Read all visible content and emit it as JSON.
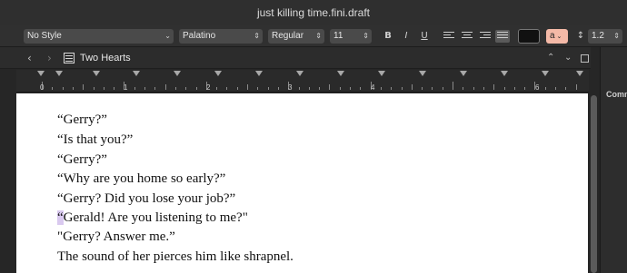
{
  "window": {
    "title": "just killing time.fini.draft"
  },
  "format_bar": {
    "style_select": "No Style",
    "font_select": "Palatino",
    "weight_select": "Regular",
    "size_select": "11",
    "bold_label": "B",
    "italic_label": "I",
    "underline_label": "U",
    "highlight_label": "a",
    "line_spacing": "1.2",
    "text_color": "#000000",
    "highlight_color": "#f4b9a7"
  },
  "nav_bar": {
    "back_icon": "chevron-left-icon",
    "forward_icon": "chevron-right-icon",
    "doc_title": "Two Hearts",
    "up_label": "^",
    "down_label": "v"
  },
  "ruler": {
    "numbers": [
      "0",
      "1",
      "2",
      "3",
      "4",
      "6"
    ]
  },
  "document": {
    "lines": [
      "“Gerry?”",
      "“Is that you?”",
      "“Gerry?”",
      "“Why are you home so early?”",
      "“Gerry? Did you lose your job?”",
      "“Gerald! Are you listening to me?\"",
      "\"Gerry? Answer me.”",
      "The sound of her pierces him like shrapnel."
    ],
    "highlight_char": "“",
    "highlight_rest": "Gerald! Are you listening to me?\""
  },
  "right_panel": {
    "label": "Comm"
  }
}
